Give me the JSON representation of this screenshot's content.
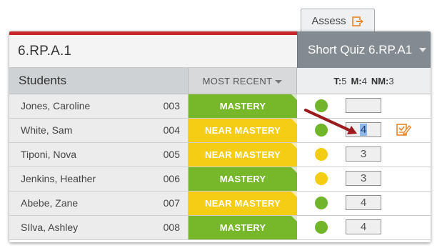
{
  "assess_tab": {
    "label": "Assess",
    "icon": "export-icon",
    "icon_color": "#e8852b"
  },
  "standard": {
    "label": "6.RP.A.1"
  },
  "quiz": {
    "title": "Short Quiz 6.RP.A1",
    "header_color": "#848b90"
  },
  "columns": {
    "students": "Students",
    "most_recent": "MOST RECENT",
    "counts": {
      "t_label": "T:",
      "t_value": "5",
      "m_label": "M:",
      "m_value": "4",
      "nm_label": "NM:",
      "nm_value": "3"
    }
  },
  "colors": {
    "mastery": "#76b82a",
    "near_mastery": "#f5cd14",
    "accent_red": "#c6252b",
    "arrow": "#9b1b1f"
  },
  "students": [
    {
      "name": "Jones, Caroline",
      "id": "003",
      "status": "MASTERY",
      "dot": "green",
      "score": ""
    },
    {
      "name": "White, Sam",
      "id": "004",
      "status": "NEAR MASTERY",
      "dot": "green",
      "score": "4"
    },
    {
      "name": "Tiponi, Nova",
      "id": "005",
      "status": "NEAR MASTERY",
      "dot": "yellow",
      "score": "3"
    },
    {
      "name": "Jenkins, Heather",
      "id": "006",
      "status": "MASTERY",
      "dot": "yellow",
      "score": "3"
    },
    {
      "name": "Abebe, Zane",
      "id": "007",
      "status": "NEAR MASTERY",
      "dot": "green",
      "score": "4"
    },
    {
      "name": "SIlva, Ashley",
      "id": "008",
      "status": "MASTERY",
      "dot": "green",
      "score": "4"
    }
  ]
}
